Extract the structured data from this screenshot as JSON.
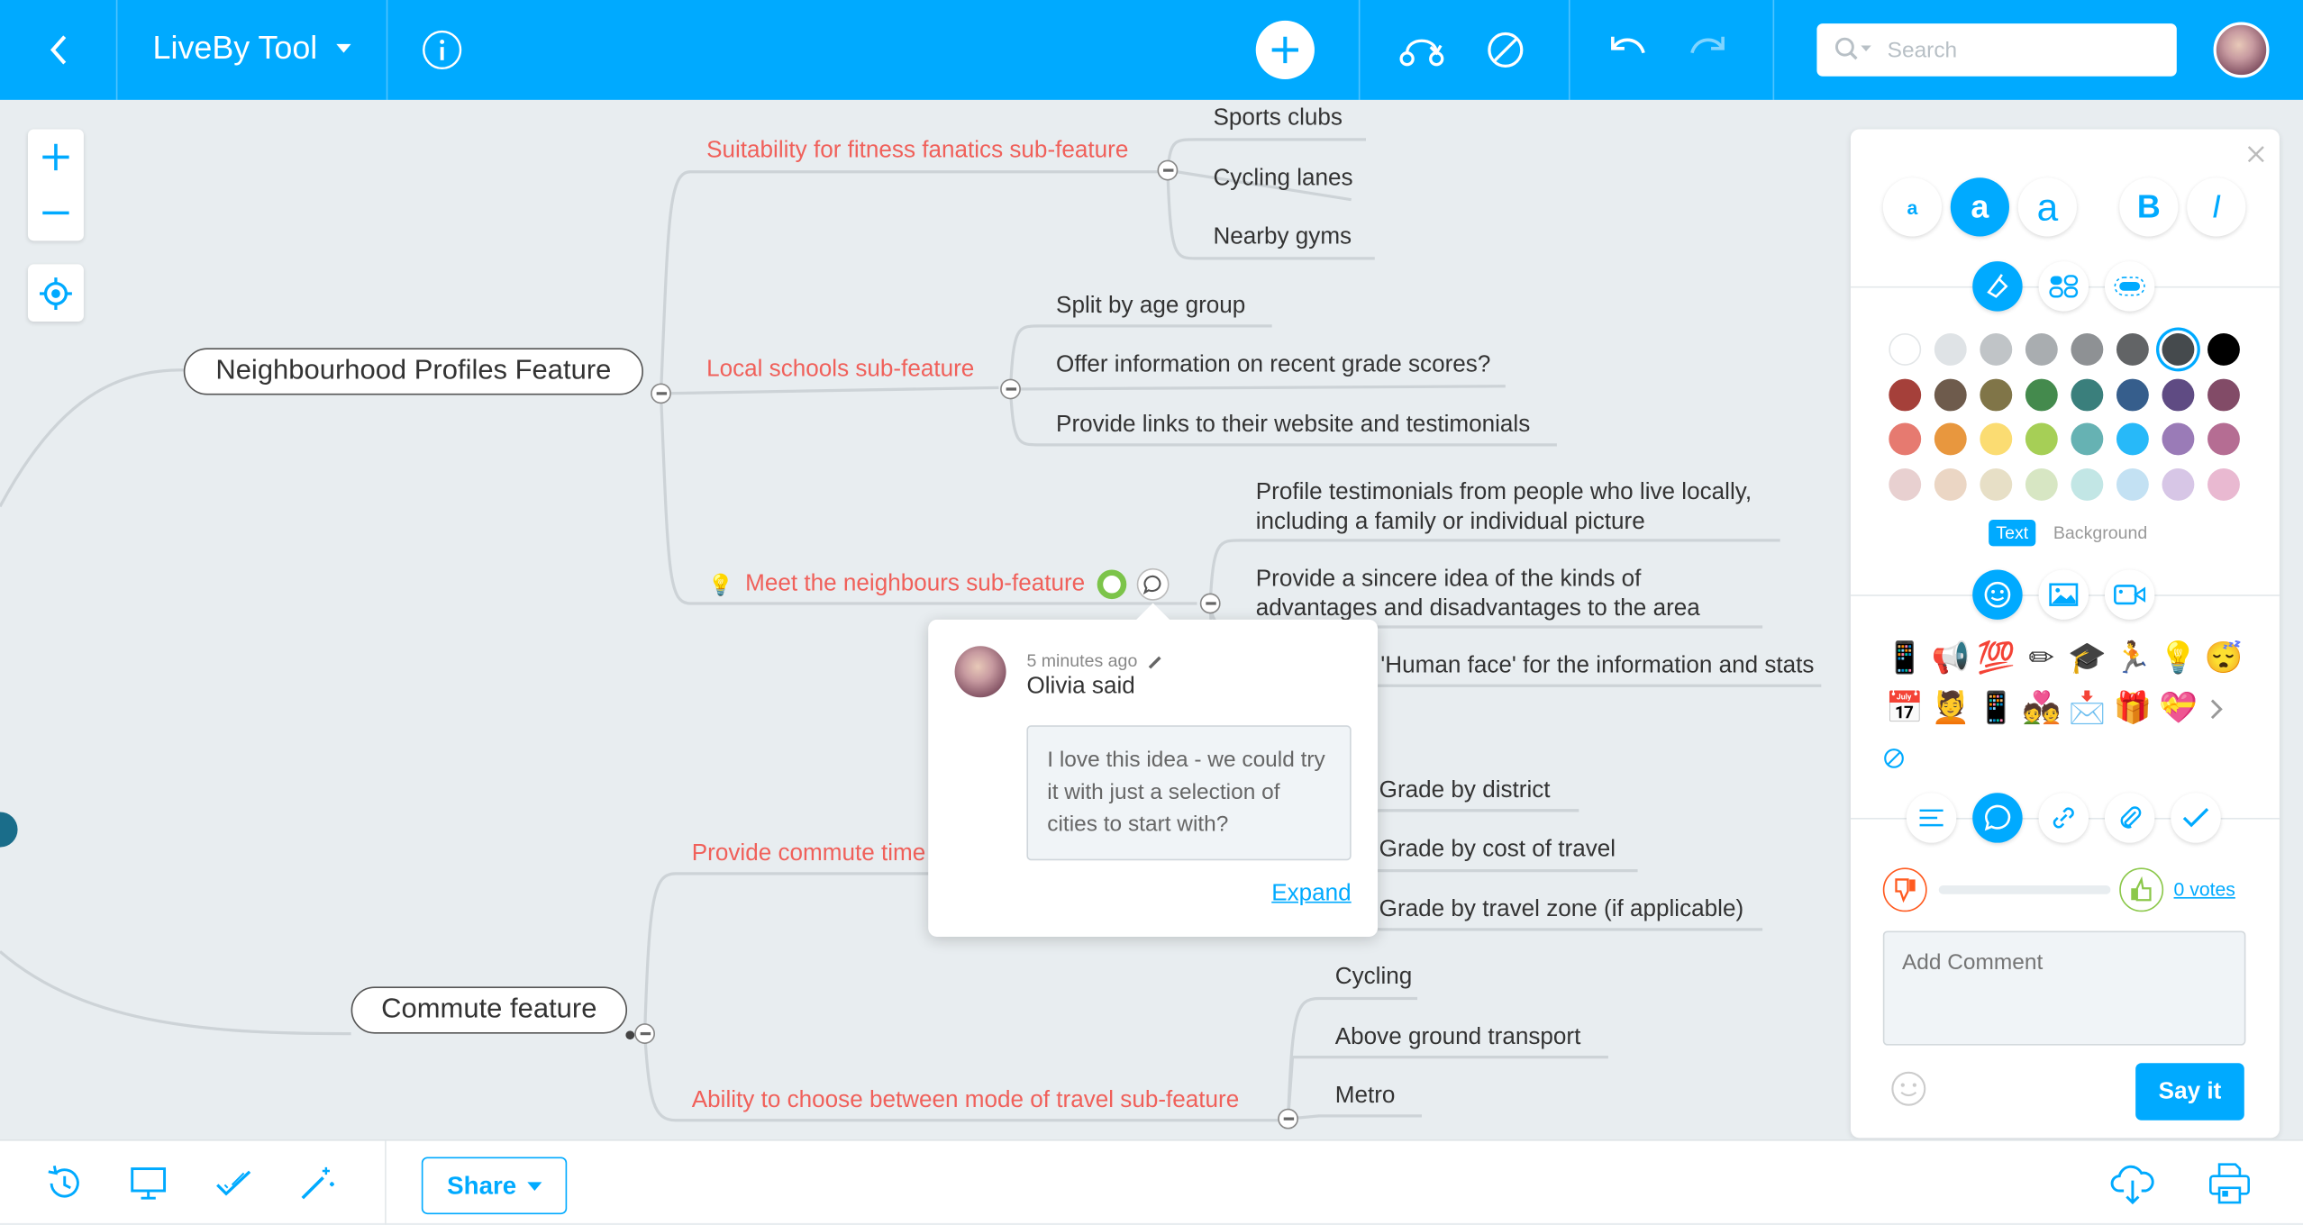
{
  "header": {
    "title": "LiveBy Tool",
    "search_placeholder": "Search",
    "accent": "#00aaff",
    "icons": [
      "chevron-left-icon",
      "caret-down-icon",
      "info-icon",
      "plus-icon",
      "route-icon",
      "ban-icon",
      "undo-icon",
      "redo-icon",
      "search-icon",
      "avatar"
    ]
  },
  "canvas": {
    "background": "#e8edf0",
    "branch_color": "#f0605a",
    "root_nodes": [
      {
        "label": "Neighbourhood Profiles Feature",
        "branches": [
          {
            "label": "Suitability for fitness fanatics sub-feature",
            "children": [
              "Sports clubs",
              "Cycling lanes",
              "Nearby gyms"
            ]
          },
          {
            "label": "Local schools sub-feature",
            "children": [
              "Split by age group",
              "Offer information on recent grade scores?",
              "Provide links to their website and testimonials"
            ]
          },
          {
            "label": "Meet the neighbours sub-feature",
            "icon": "lightbulb-icon",
            "children": [
              "Profile testimonials from people who live locally, including a family or individual picture",
              "Provide a sincere idea of the kinds of advantages and disadvantages to the area",
              "'Human face' for the information and stats"
            ]
          }
        ]
      },
      {
        "label": "Commute feature",
        "branches": [
          {
            "label": "Provide commute time",
            "children": [
              "Grade by district",
              "Grade by cost of travel",
              "Grade by travel zone (if applicable)"
            ]
          },
          {
            "label": "Ability to choose between mode of travel sub-feature",
            "children": [
              "Cycling",
              "Above ground transport",
              "Metro"
            ]
          }
        ]
      }
    ]
  },
  "popup": {
    "time": "5 minutes ago",
    "author": "Olivia said",
    "comment": "I love this idea - we could try it with just a selection of cities to start with?",
    "expand": "Expand"
  },
  "panel": {
    "font_sizes": [
      "a",
      "a",
      "a"
    ],
    "bold": "B",
    "italic": "I",
    "selected_font_size": "medium",
    "color_rows": [
      [
        "#ffffff",
        "#dfe3e6",
        "#c0c4c7",
        "#a9adb0",
        "#8e9194",
        "#626466",
        "#454a4d",
        "#000000"
      ],
      [
        "#a5403a",
        "#6e5b4c",
        "#807548",
        "#448a4d",
        "#3a7f7c",
        "#365e8c",
        "#5f4b83",
        "#824b67"
      ],
      [
        "#e67a70",
        "#e8973e",
        "#fbdc72",
        "#a6cf56",
        "#66b2b3",
        "#27b9f9",
        "#9a7bb7",
        "#b56d93"
      ],
      [
        "#e8d0d0",
        "#ebd6c4",
        "#e7dfc6",
        "#d7e6c3",
        "#c2e6e5",
        "#c3e1f3",
        "#d7c6e6",
        "#e9b9d1"
      ]
    ],
    "selected_color": "#454a4d",
    "text_tab": "Text",
    "background_tab": "Background",
    "emojis": [
      [
        "📱",
        "📢",
        "💯",
        "✏",
        "🎓",
        "🏃",
        "💡",
        "😴"
      ],
      [
        "📅",
        "💆",
        "📱",
        "💑",
        "📩",
        "🎁",
        "💝"
      ]
    ],
    "votes": "0 votes",
    "vote_progress": 0,
    "comment_placeholder": "Add Comment",
    "submit": "Say it"
  },
  "footer": {
    "share": "Share",
    "icons": [
      "history-icon",
      "presentation-icon",
      "check-icon",
      "magic-wand-icon",
      "cloud-download-icon",
      "print-icon"
    ]
  }
}
